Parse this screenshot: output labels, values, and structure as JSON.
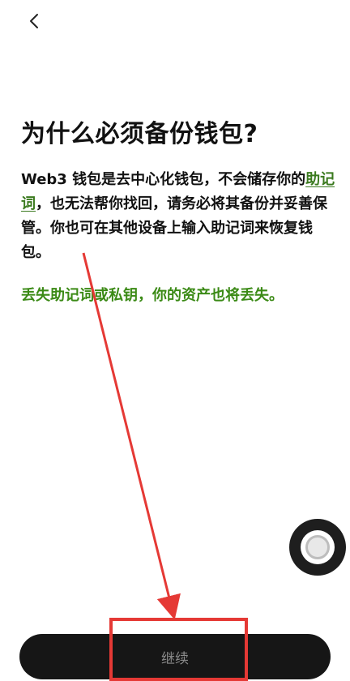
{
  "header": {
    "back_icon": "chevron-left-icon"
  },
  "content": {
    "title": "为什么必须备份钱包?",
    "body_part1": "Web3 钱包是去中心化钱包，不会储存你的",
    "body_link": "助记词",
    "body_part2": "，也无法帮你找回，请务必将其备份并妥善保管。你也可在其他设备上输入助记词来恢复钱包。",
    "warning": "丢失助记词或私钥，你的资产也将丢失。"
  },
  "footer": {
    "continue_label": "继续"
  },
  "colors": {
    "link": "#3b7a1f",
    "warning": "#3b8a16",
    "button_bg": "#161616",
    "annotation": "#e53935"
  }
}
